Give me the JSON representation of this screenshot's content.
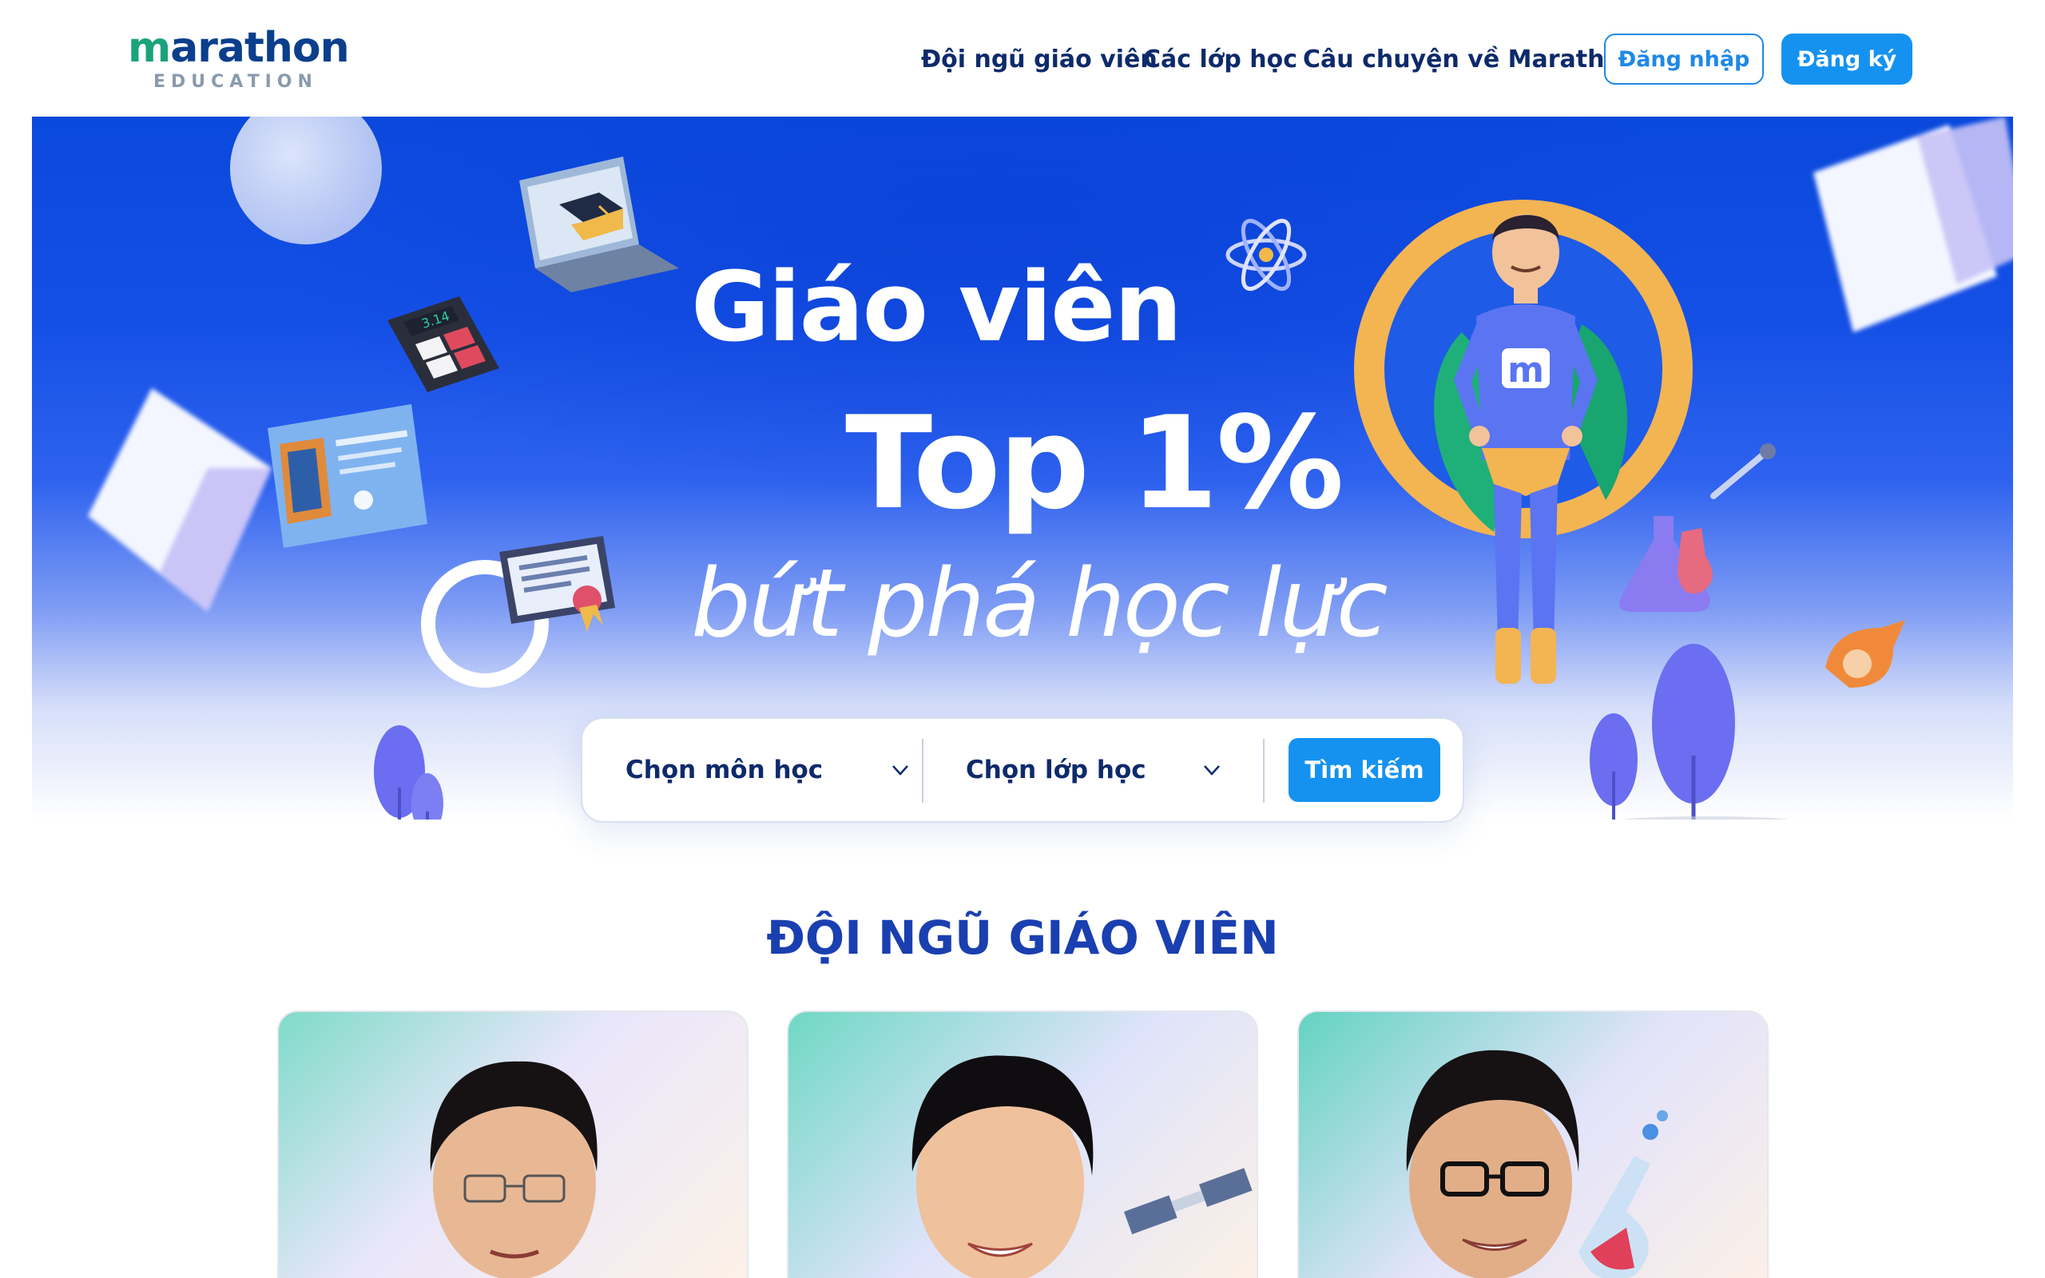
{
  "brand": {
    "name_prefix": "m",
    "name_rest": "arathon",
    "subtitle": "EDUCATION"
  },
  "nav": {
    "links": [
      "Đội ngũ giáo viên",
      "Các lớp học",
      "Câu chuyện về Marathon"
    ],
    "login_label": "Đăng nhập",
    "signup_label": "Đăng ký"
  },
  "hero": {
    "line1": "Giáo viên",
    "line2": "Top 1%",
    "line3": "bứt phá học lực",
    "mascot_badge": "m",
    "calculator_display": "3.14"
  },
  "search": {
    "subject_label": "Chọn môn học",
    "grade_label": "Chọn lớp học",
    "search_button": "Tìm kiếm"
  },
  "section": {
    "title": "ĐỘI NGŨ GIÁO VIÊN"
  },
  "teachers": [
    "teacher-1",
    "teacher-2",
    "teacher-3"
  ],
  "colors": {
    "primary": "#1592f0",
    "navy": "#0d2a6b",
    "hero_blue": "#0a49dc",
    "title_blue": "#1a3fb0",
    "logo_green": "#1aa37a"
  },
  "icons": [
    "chevron-down-icon",
    "graduation-laptop-icon",
    "calculator-icon",
    "atom-icon",
    "certificate-icon",
    "flask-icon",
    "dropper-icon",
    "rocket-icon"
  ]
}
